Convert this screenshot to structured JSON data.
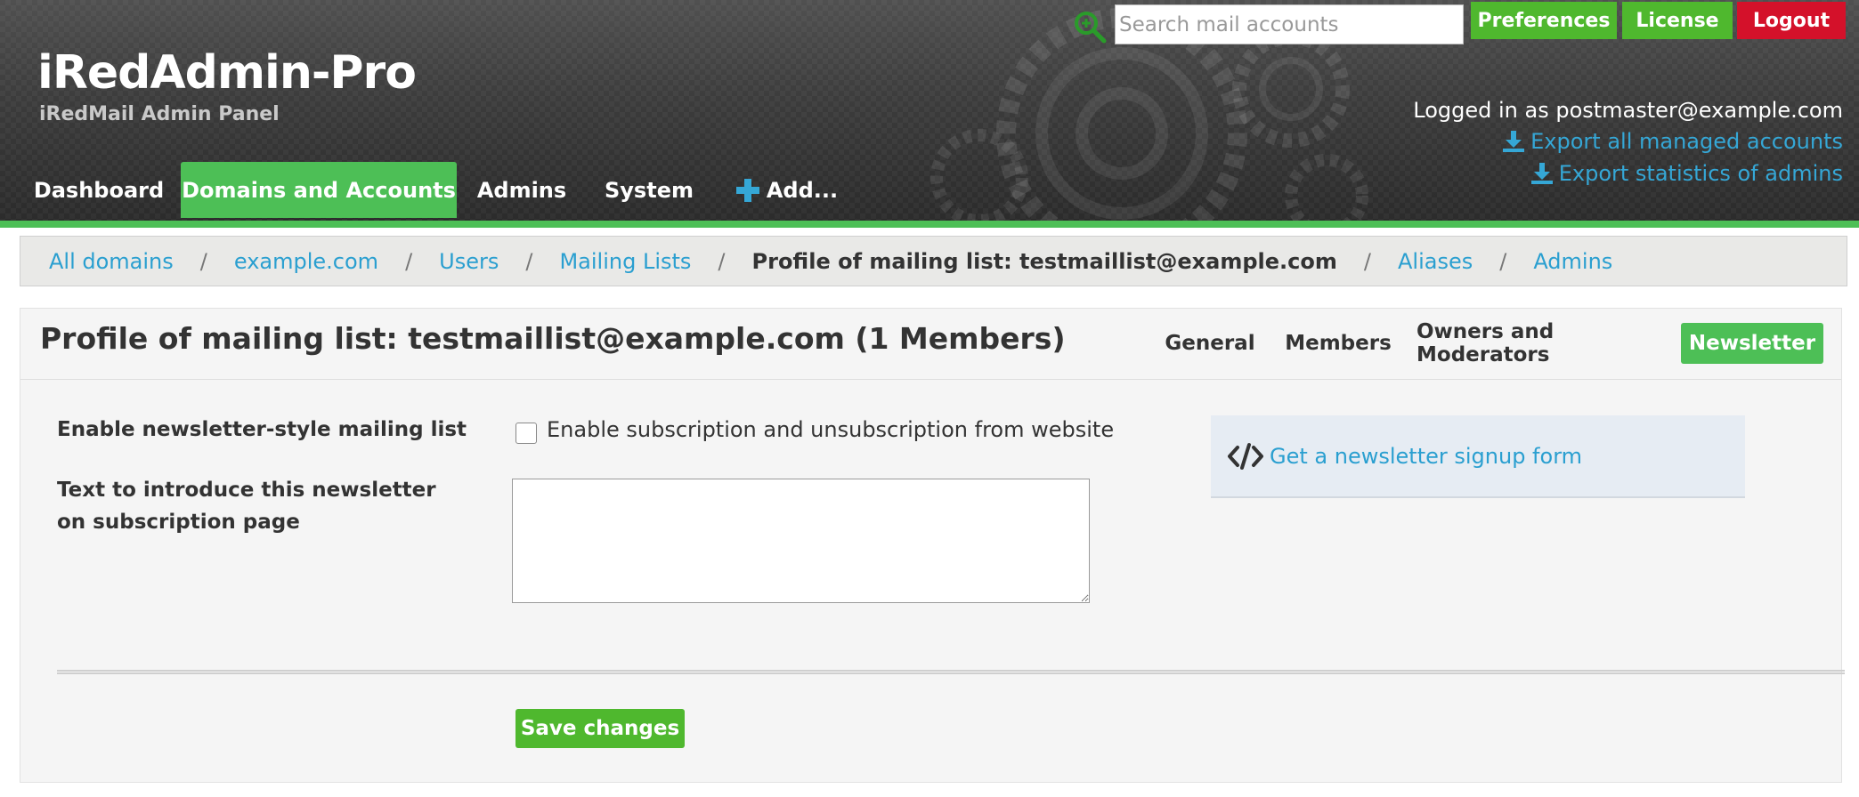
{
  "header": {
    "brand_title": "iRedAdmin-Pro",
    "brand_subtitle": "iRedMail Admin Panel",
    "search": {
      "placeholder": "Search mail accounts",
      "value": ""
    },
    "top_buttons": {
      "preferences": "Preferences",
      "license": "License",
      "logout": "Logout"
    },
    "logged_in": "Logged in as postmaster@example.com",
    "export_accounts": "Export all managed accounts",
    "export_stats": "Export statistics of admins",
    "nav": {
      "dashboard": "Dashboard",
      "domains": "Domains and Accounts",
      "admins": "Admins",
      "system": "System",
      "add": "Add..."
    }
  },
  "breadcrumb": {
    "all_domains": "All domains",
    "domain": "example.com",
    "users": "Users",
    "mailing_lists": "Mailing Lists",
    "current": "Profile of mailing list: testmaillist@example.com",
    "aliases": "Aliases",
    "admins": "Admins",
    "separator": "/"
  },
  "panel": {
    "title": "Profile of mailing list: testmaillist@example.com (1 Members)",
    "tabs": {
      "general": "General",
      "members": "Members",
      "owners": "Owners and Moderators",
      "newsletter": "Newsletter"
    },
    "enable_label": "Enable newsletter-style mailing list",
    "enable_checkbox_label": "Enable subscription and unsubscription from website",
    "intro_label": "Text to introduce this newsletter on subscription page",
    "intro_value": "",
    "signup_link": "Get a newsletter signup form",
    "save_button": "Save changes"
  },
  "colors": {
    "accent_green": "#4dbf56",
    "button_green": "#4fb82e",
    "logout_red": "#d4112a",
    "link_blue": "#2a9fd0"
  },
  "icons": {
    "search": "search-icon",
    "download": "download-icon",
    "plus": "plus-icon",
    "code": "code-icon"
  }
}
